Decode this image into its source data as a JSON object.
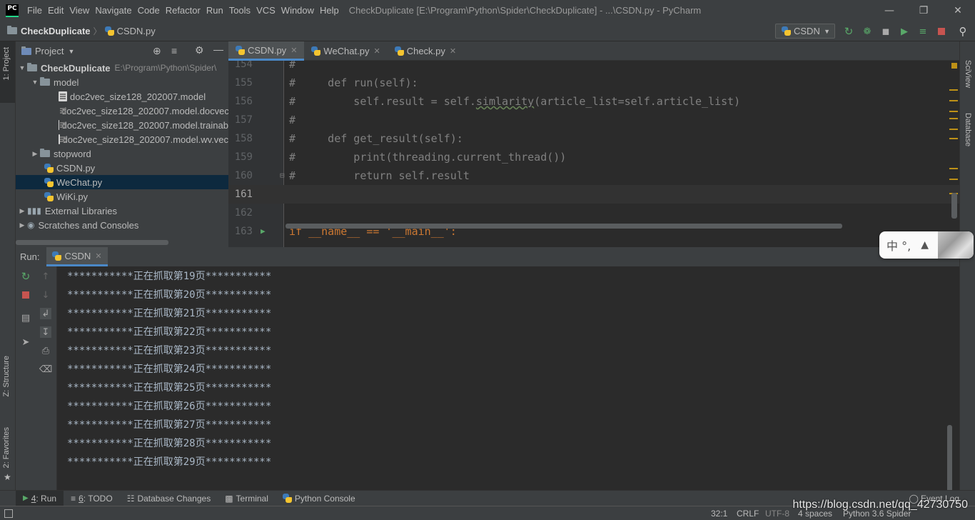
{
  "app": {
    "logo_text": "PC",
    "window_title": "CheckDuplicate [E:\\Program\\Python\\Spider\\CheckDuplicate] - ...\\CSDN.py - PyCharm"
  },
  "menu": [
    "File",
    "Edit",
    "View",
    "Navigate",
    "Code",
    "Refactor",
    "Run",
    "Tools",
    "VCS",
    "Window",
    "Help"
  ],
  "breadcrumb": {
    "project": "CheckDuplicate",
    "file": "CSDN.py"
  },
  "run_config": "CSDN",
  "project_panel": {
    "title": "Project",
    "tree": [
      {
        "label": "CheckDuplicate",
        "path": "E:\\Program\\Python\\Spider\\"
      },
      {
        "label": "model"
      },
      {
        "label": "doc2vec_size128_202007.model"
      },
      {
        "label": "doc2vec_size128_202007.model.docvec"
      },
      {
        "label": "doc2vec_size128_202007.model.trainab"
      },
      {
        "label": "doc2vec_size128_202007.model.wv.vec"
      },
      {
        "label": "stopword"
      },
      {
        "label": "CSDN.py"
      },
      {
        "label": "WeChat.py"
      },
      {
        "label": "WiKi.py"
      },
      {
        "label": "External Libraries"
      },
      {
        "label": "Scratches and Consoles"
      }
    ]
  },
  "editor_tabs": [
    "CSDN.py",
    "WeChat.py",
    "Check.py"
  ],
  "code_lines": [
    {
      "num": "154",
      "code": "#"
    },
    {
      "num": "155",
      "code": "#     def run(self):"
    },
    {
      "num": "156",
      "code_pre": "#         self.result = self.",
      "code_squiggle": "simlarity",
      "code_post": "(article_list=self.article_list)"
    },
    {
      "num": "157",
      "code": "#"
    },
    {
      "num": "158",
      "code": "#     def get_result(self):"
    },
    {
      "num": "159",
      "code": "#         print(threading.current_thread())"
    },
    {
      "num": "160",
      "code": "#         return self.result"
    },
    {
      "num": "161",
      "code": ""
    },
    {
      "num": "162",
      "code": ""
    },
    {
      "num": "163",
      "code": "if __name__ == '__main__':"
    }
  ],
  "run_panel": {
    "label": "Run:",
    "tab": "CSDN",
    "output": [
      "***********正在抓取第19页***********",
      "***********正在抓取第20页***********",
      "***********正在抓取第21页***********",
      "***********正在抓取第22页***********",
      "***********正在抓取第23页***********",
      "***********正在抓取第24页***********",
      "***********正在抓取第25页***********",
      "***********正在抓取第26页***********",
      "***********正在抓取第27页***********",
      "***********正在抓取第28页***********",
      "***********正在抓取第29页***********"
    ]
  },
  "ime": {
    "text": "中 °,"
  },
  "left_tabs": {
    "project": "1: Project",
    "structure": "Z: Structure",
    "favorites": "2: Favorites"
  },
  "right_tabs": {
    "sciview": "SciView",
    "database": "Database"
  },
  "bottom_tabs": [
    {
      "num": "4",
      "label": ": Run"
    },
    {
      "num": "6",
      "label": ": TODO"
    },
    {
      "label": "Database Changes"
    },
    {
      "label": "Terminal"
    },
    {
      "label": "Python Console"
    }
  ],
  "event_log": "Event Log",
  "status": {
    "position": "32:1",
    "line_sep": "CRLF",
    "encoding": "UTF-8",
    "indent": "4 spaces",
    "interpreter": "Python 3.6 Spider"
  },
  "watermark": "https://blog.csdn.net/qq_42730750",
  "colors": {
    "accent": "#4a88c7",
    "bg": "#2b2b2b",
    "panel": "#3c3f41",
    "selection": "#0d293e",
    "comment": "#808080",
    "output": "#a9b7c6"
  }
}
